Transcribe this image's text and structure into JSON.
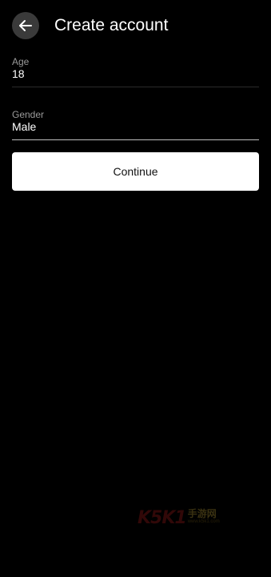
{
  "header": {
    "title": "Create account",
    "back_icon": "arrow-left-icon"
  },
  "form": {
    "age": {
      "label": "Age",
      "value": "18"
    },
    "gender": {
      "label": "Gender",
      "value": "Male"
    }
  },
  "continue_button": {
    "label": "Continue"
  },
  "watermark": {
    "brand": "K5K1",
    "cn_text": "手游网",
    "sub_text": "www.k5k1.com"
  },
  "colors": {
    "background": "#000000",
    "button_bg": "#ffffff",
    "back_button_bg": "#3a3a3a",
    "label": "#9a9a9a"
  }
}
